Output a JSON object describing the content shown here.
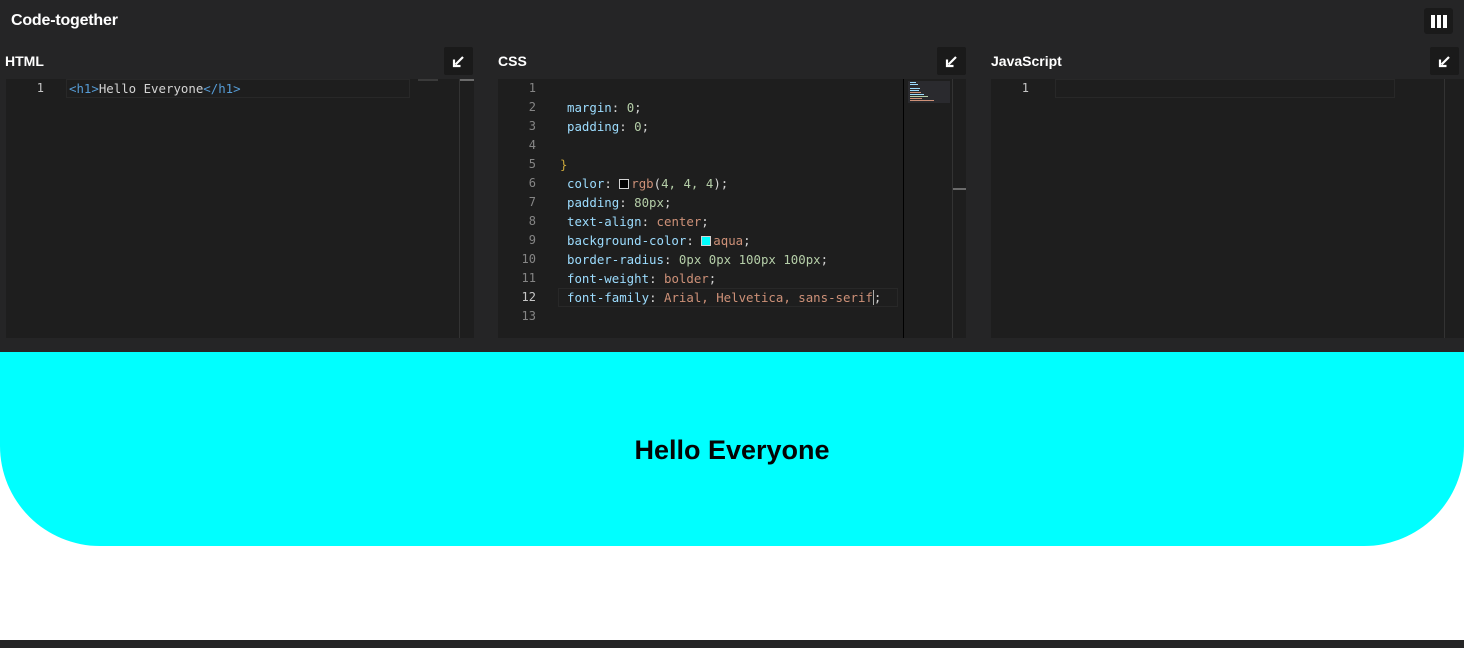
{
  "app": {
    "title": "Code-together",
    "layout_icon": "columns-icon"
  },
  "panes": {
    "html": {
      "title": "HTML",
      "collapse_icon": "arrow-down-left-icon",
      "line_numbers": [
        "1"
      ],
      "code": {
        "l1_open": "<h1>",
        "l1_text": "Hello Everyone",
        "l1_close": "</h1>"
      }
    },
    "css": {
      "title": "CSS",
      "collapse_icon": "arrow-down-left-icon",
      "line_numbers": [
        "1",
        "2",
        "3",
        "4",
        "5",
        "6",
        "7",
        "8",
        "9",
        "10",
        "11",
        "12",
        "13"
      ],
      "code": {
        "l2_prop": "margin",
        "l2_val": "0",
        "l3_prop": "padding",
        "l3_val": "0",
        "l5_brace": "}",
        "l6_prop": "color",
        "l6_val": "rgb(4, 4, 4)",
        "l6_fn": "rgb",
        "l6_args": "4, 4, 4",
        "l7_prop": "padding",
        "l7_val": "80px",
        "l8_prop": "text-align",
        "l8_val": "center",
        "l9_prop": "background-color",
        "l9_val": "aqua",
        "l10_prop": "border-radius",
        "l10_val": "0px 0px 100px 100px",
        "l11_prop": "font-weight",
        "l11_val": "bolder",
        "l12_prop": "font-family",
        "l12_val": "Arial, Helvetica, sans-serif"
      },
      "swatch_colors": {
        "color": "#040404",
        "background": "#00ffff"
      }
    },
    "javascript": {
      "title": "JavaScript",
      "collapse_icon": "arrow-down-left-icon",
      "line_numbers": [
        "1"
      ]
    }
  },
  "preview": {
    "heading": "Hello Everyone",
    "background": "#00ffff",
    "text_color": "#040404"
  }
}
